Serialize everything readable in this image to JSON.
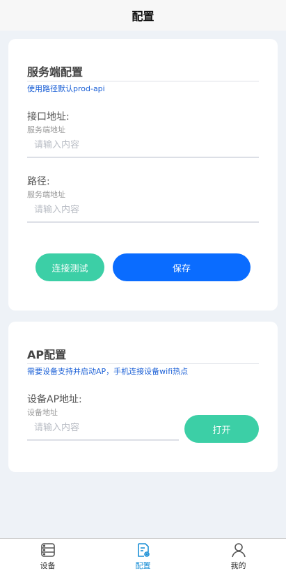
{
  "header": {
    "title": "配置"
  },
  "server": {
    "title": "服务端配置",
    "hint": "使用路径默认prod-api",
    "address": {
      "label": "接口地址:",
      "sub": "服务端地址",
      "placeholder": "请输入内容",
      "value": ""
    },
    "path": {
      "label": "路径:",
      "sub": "服务端地址",
      "placeholder": "请输入内容",
      "value": ""
    },
    "test_button": "连接测试",
    "save_button": "保存"
  },
  "ap": {
    "title": "AP配置",
    "hint": "需要设备支持并启动AP，手机连接设备wifi热点",
    "address": {
      "label": "设备AP地址:",
      "sub": "设备地址",
      "placeholder": "请输入内容",
      "value": ""
    },
    "open_button": "打开"
  },
  "tabbar": {
    "active": "config",
    "items": [
      {
        "id": "device",
        "label": "设备",
        "icon": "device-icon"
      },
      {
        "id": "config",
        "label": "配置",
        "icon": "config-icon"
      },
      {
        "id": "mine",
        "label": "我的",
        "icon": "user-icon"
      }
    ],
    "active_color": "#1a8fd6"
  },
  "colors": {
    "primary": "#0a6cff",
    "accent": "#3ccfa6",
    "hint": "#1a5fd6"
  }
}
